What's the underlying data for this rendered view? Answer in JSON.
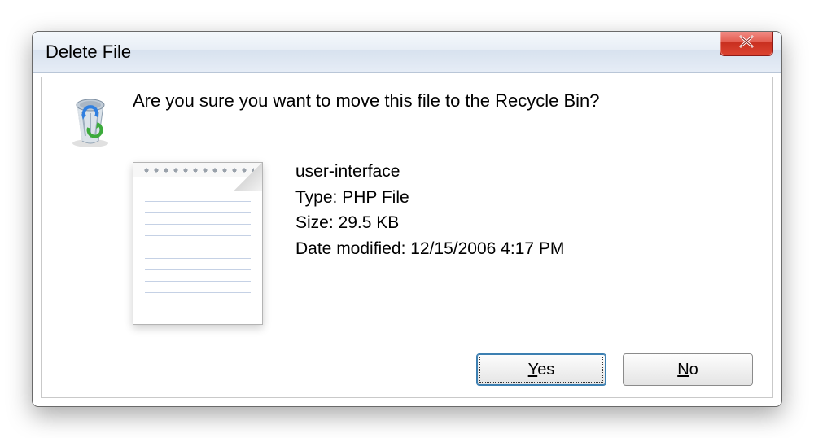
{
  "dialog": {
    "title": "Delete File",
    "question": "Are you sure you want to move this file to the Recycle Bin?",
    "file": {
      "name": "user-interface",
      "type_label": "Type: PHP File",
      "size_label": "Size: 29.5 KB",
      "modified_label": "Date modified: 12/15/2006 4:17 PM"
    },
    "buttons": {
      "yes": "Yes",
      "no": "No"
    }
  }
}
